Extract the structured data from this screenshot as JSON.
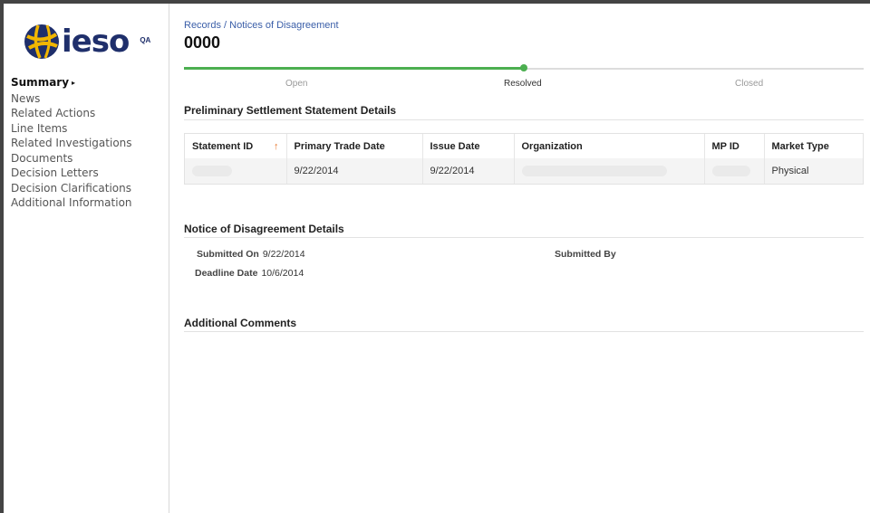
{
  "brand": {
    "name": "ieso",
    "env": "QA",
    "colors": {
      "navy": "#1f2f6b",
      "accent": "#4caf50"
    }
  },
  "nav": {
    "items": [
      {
        "label": "Summary",
        "active": true
      },
      {
        "label": "News"
      },
      {
        "label": "Related Actions"
      },
      {
        "label": "Line Items"
      },
      {
        "label": "Related Investigations"
      },
      {
        "label": "Documents"
      },
      {
        "label": "Decision Letters"
      },
      {
        "label": "Decision Clarifications"
      },
      {
        "label": "Additional Information"
      }
    ],
    "active_marker": "▸"
  },
  "header": {
    "breadcrumb_records": "Records",
    "breadcrumb_sep": " / ",
    "breadcrumb_notices": "Notices of Disagreement",
    "title": "0000"
  },
  "progress": {
    "stages": [
      "Open",
      "Resolved",
      "Closed"
    ],
    "current_index": 1
  },
  "statement": {
    "title": "Preliminary Settlement Statement Details",
    "columns": [
      "Statement ID",
      "Primary Trade Date",
      "Issue Date",
      "Organization",
      "MP ID",
      "Market Type"
    ],
    "sort_icon": "↑",
    "row": {
      "primary_trade_date": "9/22/2014",
      "issue_date": "9/22/2014",
      "market_type": "Physical"
    }
  },
  "nod": {
    "title": "Notice of Disagreement Details",
    "submitted_on_label": "Submitted On",
    "submitted_on": "9/22/2014",
    "deadline_label": "Deadline Date",
    "deadline": "10/6/2014",
    "submitted_by_label": "Submitted By"
  },
  "comments": {
    "title": "Additional Comments"
  }
}
